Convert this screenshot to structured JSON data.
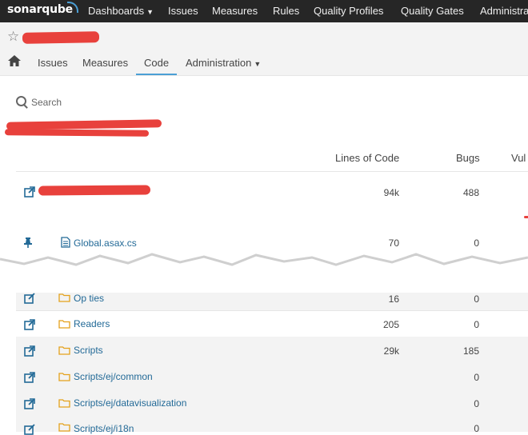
{
  "topnav": {
    "logo": "sonarqube",
    "items": [
      {
        "label": "Dashboards",
        "has_caret": true
      },
      {
        "label": "Issues"
      },
      {
        "label": "Measures"
      },
      {
        "label": "Rules"
      },
      {
        "label": "Quality Profiles"
      },
      {
        "label": "Quality Gates"
      },
      {
        "label": "Administra"
      }
    ]
  },
  "project_tabs": {
    "items": [
      {
        "label": "Issues"
      },
      {
        "label": "Measures"
      },
      {
        "label": "Code",
        "active": true
      },
      {
        "label": "Administration",
        "has_caret": true
      }
    ]
  },
  "search": {
    "label": "Search"
  },
  "table": {
    "headers": {
      "loc": "Lines of Code",
      "bugs": "Bugs",
      "vuln": "Vul"
    },
    "base_row": {
      "loc": "94k",
      "bugs": "488"
    },
    "pinned_row": {
      "name": "Global.asax.cs",
      "loc": "70",
      "bugs": "0"
    },
    "partial_row": {
      "name": "Op ties",
      "loc": "16",
      "bugs": "0"
    },
    "rows": [
      {
        "name": "Readers",
        "loc": "205",
        "bugs": "0"
      },
      {
        "name": "Scripts",
        "loc": "29k",
        "bugs": "185"
      },
      {
        "name": "Scripts/ej/common",
        "loc": "",
        "bugs": "0"
      },
      {
        "name": "Scripts/ej/datavisualization",
        "loc": "",
        "bugs": "0"
      },
      {
        "name": "Scripts/ej/i18n",
        "loc": "",
        "bugs": "0"
      }
    ]
  },
  "colors": {
    "topnav_bg": "#262626",
    "accent": "#4b9fd5",
    "link": "#236a97",
    "folder": "#e4a11b",
    "redaction": "#e8413c"
  }
}
